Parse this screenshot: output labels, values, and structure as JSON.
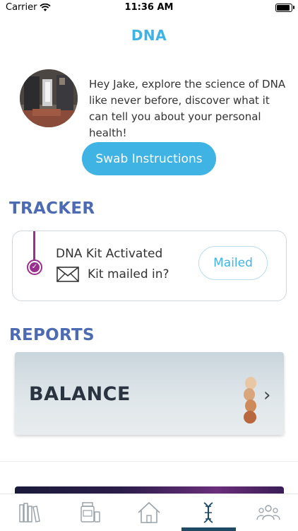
{
  "status_bar": {
    "carrier": "Carrier",
    "time": "11:36 AM"
  },
  "header": {
    "title": "DNA"
  },
  "welcome": {
    "message": "Hey Jake, explore the science of DNA like never before, discover what it can tell you about your personal health!"
  },
  "buttons": {
    "swab_instructions": "Swab Instructions"
  },
  "tracker": {
    "heading": "TRACKER",
    "step_activated": "DNA Kit Activated",
    "step_mailed": "Kit mailed in?",
    "mailed_button": "Mailed"
  },
  "reports": {
    "heading": "REPORTS",
    "cards": [
      {
        "label": "BALANCE"
      }
    ]
  },
  "tab_bar": {
    "items": [
      {
        "icon": "library-books-icon"
      },
      {
        "icon": "supplements-icon"
      },
      {
        "icon": "home-icon"
      },
      {
        "icon": "dna-icon",
        "active": true
      },
      {
        "icon": "community-icon"
      }
    ]
  },
  "colors": {
    "accent": "#3fb3e3",
    "heading": "#4c6bb3",
    "tracker": "#9b2f8e",
    "tab_active": "#1e4a66"
  }
}
